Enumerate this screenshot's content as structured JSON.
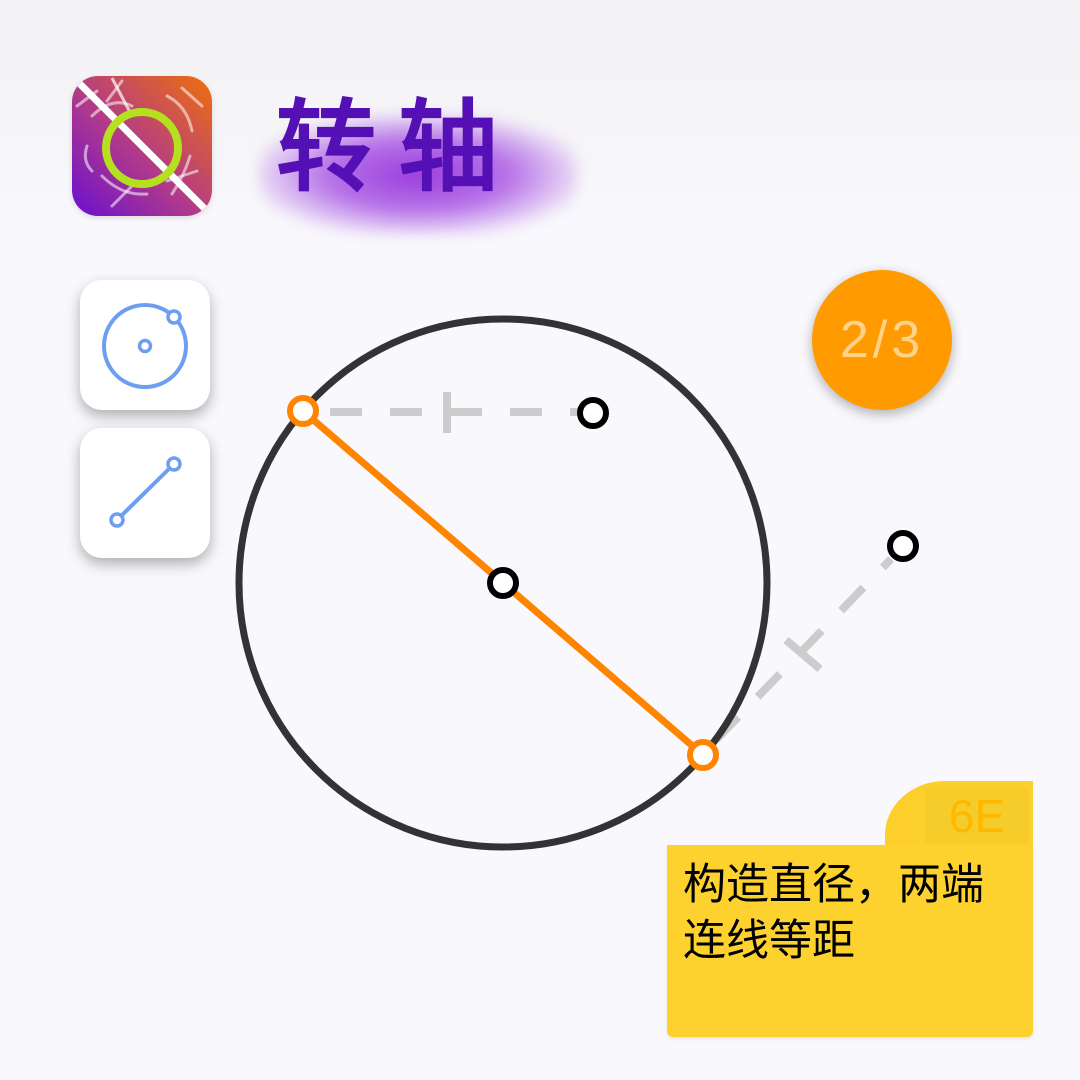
{
  "app": {
    "title": "转轴",
    "logo_icon": "puzzle-logo-icon",
    "title_color": "#5410b4"
  },
  "toolbar": {
    "tools": [
      {
        "name": "circle-tool",
        "icon": "circle-point-icon",
        "color": "#6e9ef0"
      },
      {
        "name": "segment-tool",
        "icon": "line-segment-icon",
        "color": "#6e9ef0"
      }
    ]
  },
  "progress": {
    "label": "2/3",
    "current": 2,
    "total": 3,
    "color": "#ff9b00"
  },
  "hint": {
    "code": "6E",
    "text_line1": "构造直径，两端",
    "text_line2": "连线等距",
    "color": "#fdd12e"
  },
  "construction": {
    "circle_color": "#333333",
    "diameter_color": "#ff8400",
    "guide_color": "#cccccc",
    "point_color": "#000000"
  }
}
